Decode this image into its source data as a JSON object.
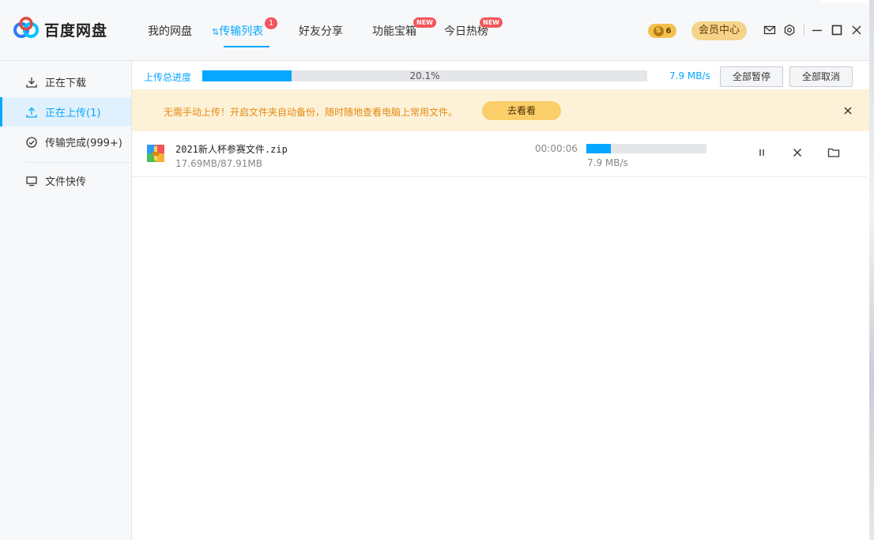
{
  "app": {
    "name": "百度网盘"
  },
  "nav": {
    "items": [
      {
        "label": "我的网盘"
      },
      {
        "label": "传输列表",
        "badge": "1"
      },
      {
        "label": "好友分享"
      },
      {
        "label": "功能宝箱",
        "tag": "NEW"
      },
      {
        "label": "今日热榜",
        "tag": "NEW"
      }
    ]
  },
  "header": {
    "coin_symbol": "S",
    "coin_count": "6",
    "vip_label": "会员中心",
    "icons": [
      "mail-icon",
      "settings-icon",
      "minimize-icon",
      "maximize-icon",
      "close-icon"
    ]
  },
  "sidebar": {
    "items": [
      {
        "label": "正在下载",
        "icon": "download-icon"
      },
      {
        "label": "正在上传(1)",
        "icon": "upload-icon"
      },
      {
        "label": "传输完成(999+)",
        "icon": "check-circle-icon"
      },
      {
        "label": "文件快传",
        "icon": "monitor-icon"
      }
    ]
  },
  "upload_progress": {
    "label": "上传总进度",
    "percent_text": "20.1%",
    "percent": 20.1,
    "speed": "7.9 MB/s",
    "pause_all_label": "全部暂停",
    "cancel_all_label": "全部取消"
  },
  "notice": {
    "text": "无需手动上传！开启文件夹自动备份，随时随地查看电脑上常用文件。",
    "button_label": "去看看"
  },
  "files": [
    {
      "name": "2021新人杯参赛文件.zip",
      "size": "17.69MB/87.91MB",
      "time_left": "00:00:06",
      "progress": 20.1,
      "speed": "7.9 MB/s"
    }
  ],
  "colors": {
    "accent": "#06a7ff",
    "badge": "#f2555a",
    "notice_bg": "#fdf2d8",
    "notice_text": "#e58a10",
    "vip_bg": "#f5d489"
  }
}
